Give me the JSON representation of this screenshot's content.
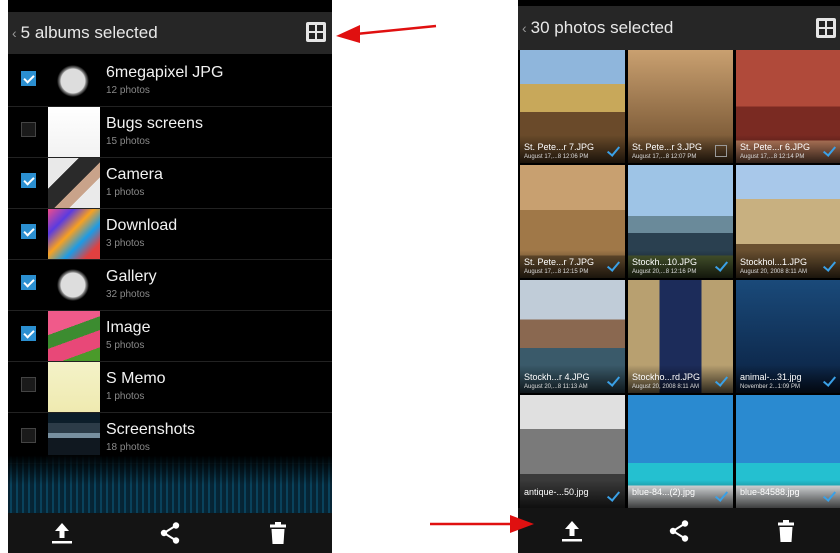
{
  "left_screen": {
    "header_title": "5 albums selected",
    "back_glyph": "‹",
    "view_toggle_icon": "grid-icon",
    "albums": [
      {
        "name": "6megapixel JPG",
        "count": "12 photos",
        "checked": true,
        "thumb": "moon"
      },
      {
        "name": "Bugs screens",
        "count": "15 photos",
        "checked": false,
        "thumb": "document"
      },
      {
        "name": "Camera",
        "count": "1 photos",
        "checked": true,
        "thumb": "person"
      },
      {
        "name": "Download",
        "count": "3 photos",
        "checked": true,
        "thumb": "colorful"
      },
      {
        "name": "Gallery",
        "count": "32 photos",
        "checked": true,
        "thumb": "moon"
      },
      {
        "name": "Image",
        "count": "5 photos",
        "checked": true,
        "thumb": "tulips"
      },
      {
        "name": "S Memo",
        "count": "1 photos",
        "checked": false,
        "thumb": "memo"
      },
      {
        "name": "Screenshots",
        "count": "18 photos",
        "checked": false,
        "thumb": "screenshot"
      }
    ],
    "bottom_actions": [
      "upload-icon",
      "share-icon",
      "trash-icon"
    ]
  },
  "right_screen": {
    "header_title": "30 photos selected",
    "back_glyph": "‹",
    "view_toggle_icon": "grid-icon",
    "photos": [
      {
        "name": "St. Pete...r 7.JPG",
        "date": "August 17,...8 12:06 PM",
        "checked": true,
        "scene": "church"
      },
      {
        "name": "St. Pete...r 3.JPG",
        "date": "August 17,...8 12:07 PM",
        "checked": false,
        "scene": "interior"
      },
      {
        "name": "St. Pete...r 6.JPG",
        "date": "August 17,...8 12:14 PM",
        "checked": true,
        "scene": "red-church"
      },
      {
        "name": "St. Pete...r 7.JPG",
        "date": "August 17,...8 12:15 PM",
        "checked": true,
        "scene": "facade"
      },
      {
        "name": "Stockh...10.JPG",
        "date": "August 20,...8 12:16 PM",
        "checked": true,
        "scene": "ship"
      },
      {
        "name": "Stockhol...1.JPG",
        "date": "August 20, 2008 8:11 AM",
        "checked": true,
        "scene": "tower"
      },
      {
        "name": "Stockh...r 4.JPG",
        "date": "August 20,...8 11:13 AM",
        "checked": true,
        "scene": "waterfront"
      },
      {
        "name": "Stockho...rd.JPG",
        "date": "August 20, 2008 8:11 AM",
        "checked": true,
        "scene": "guard"
      },
      {
        "name": "animal-...31.jpg",
        "date": "November 2...1:09 PM",
        "checked": true,
        "scene": "shark"
      },
      {
        "name": "antique-...50.jpg",
        "date": "",
        "checked": true,
        "scene": "car"
      },
      {
        "name": "blue-84...(2).jpg",
        "date": "",
        "checked": true,
        "scene": "sail"
      },
      {
        "name": "blue-84588.jpg",
        "date": "",
        "checked": true,
        "scene": "sail"
      }
    ],
    "bottom_actions": [
      "upload-icon",
      "share-icon",
      "trash-icon"
    ]
  },
  "annotations": {
    "arrow_color": "#e01010"
  },
  "colors": {
    "accent": "#2b8fd0",
    "header_bg": "#262626",
    "screen_bg": "#000000"
  }
}
